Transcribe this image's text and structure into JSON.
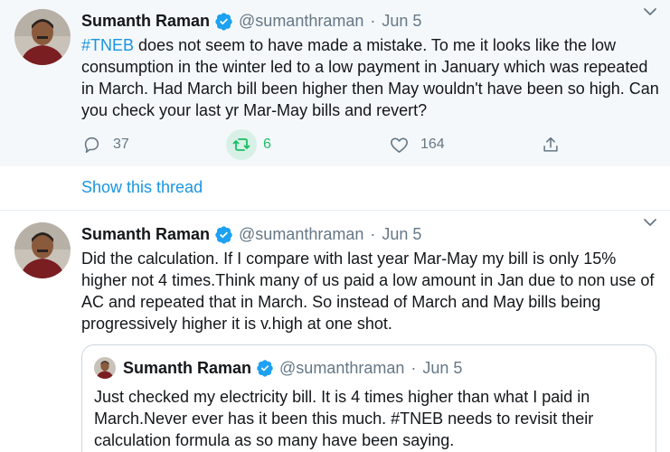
{
  "tweets": [
    {
      "name": "Sumanth Raman",
      "handle": "@sumanthraman",
      "separator": "·",
      "date": "Jun 5",
      "hashtag": "#TNEB",
      "text_after_hashtag": " does not seem to have made a mistake. To me it looks like the low consumption in the winter led to a low payment in January which was repeated in March. Had March bill been higher then May wouldn't have been so high. Can you check your last yr Mar-May bills and revert?",
      "replies": "37",
      "retweets": "6",
      "likes": "164"
    },
    {
      "name": "Sumanth Raman",
      "handle": "@sumanthraman",
      "separator": "·",
      "date": "Jun 5",
      "text": "Did the calculation. If I compare with last year Mar-May my bill is only 15% higher not 4 times.Think many of us paid a low amount in Jan due to non use of AC and repeated that in March. So instead of March and May bills being progressively higher it is v.high at one shot.",
      "quoted": {
        "name": "Sumanth Raman",
        "handle": "@sumanthraman",
        "separator": "·",
        "date": "Jun 5",
        "text": "Just checked my electricity bill. It is 4 times higher than what I paid in March.Never ever has it been this much. #TNEB needs to revisit their calculation formula as so many have been saying."
      }
    }
  ],
  "show_thread_label": "Show this thread",
  "icons": {
    "verified": "verified-badge-icon",
    "chevron": "chevron-down-icon",
    "reply": "reply-icon",
    "retweet": "retweet-icon",
    "like": "heart-icon",
    "share": "share-icon"
  },
  "colors": {
    "accent": "#1b95e0",
    "retweet_active": "#17bf63",
    "muted": "#657786",
    "highlight_bg": "#f5f8fa"
  }
}
